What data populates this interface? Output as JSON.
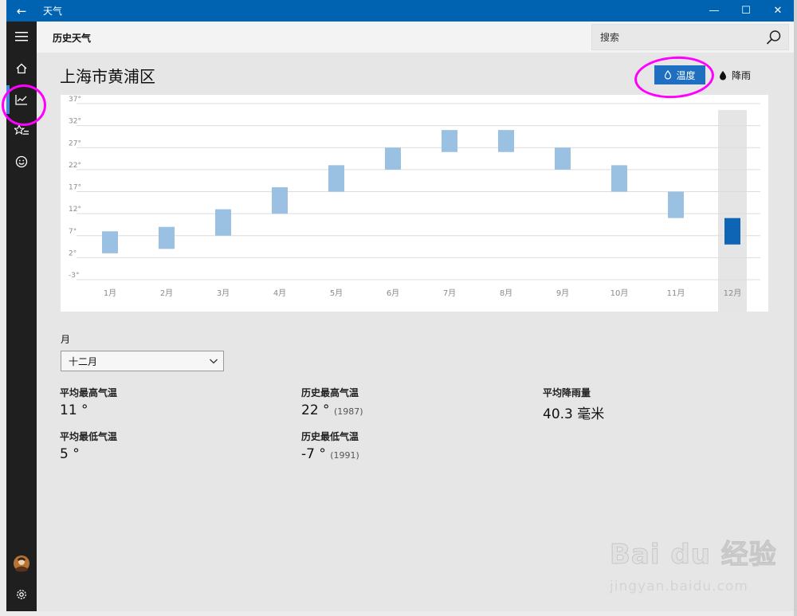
{
  "window": {
    "title": "天气",
    "back_glyph": "←",
    "min_glyph": "—",
    "max_glyph": "☐",
    "close_glyph": "✕"
  },
  "header": {
    "title": "历史天气",
    "search_placeholder": "搜索"
  },
  "location": "上海市黄浦区",
  "toggle": {
    "temperature": "温度",
    "precipitation": "降雨"
  },
  "chart_data": {
    "type": "bar",
    "categories": [
      "1月",
      "2月",
      "3月",
      "4月",
      "5月",
      "6月",
      "7月",
      "8月",
      "9月",
      "10月",
      "11月",
      "12月"
    ],
    "series": [
      {
        "low": [
          3,
          4,
          7,
          12,
          17,
          22,
          26,
          26,
          22,
          17,
          11,
          5
        ],
        "high": [
          8,
          9,
          13,
          18,
          23,
          27,
          31,
          31,
          27,
          23,
          17,
          11
        ]
      }
    ],
    "selected_index": 11,
    "y_tick_labels": [
      "37°",
      "32°",
      "27°",
      "22°",
      "17°",
      "12°",
      "7°",
      "2°",
      "-3°"
    ],
    "ylim": [
      -3,
      37
    ],
    "grid": true,
    "colors": {
      "bar": "#9ac1e1",
      "selected": "#0f65b5",
      "selected_band": "#e5e5e5"
    }
  },
  "month": {
    "label": "月",
    "selected": "十二月"
  },
  "stats": {
    "avg_high": {
      "label": "平均最高气温",
      "value": "11 °"
    },
    "avg_low": {
      "label": "平均最低气温",
      "value": "5 °"
    },
    "record_high": {
      "label": "历史最高气温",
      "value": "22 °",
      "year": "(1987)"
    },
    "record_low": {
      "label": "历史最低气温",
      "value": "-7 °",
      "year": "(1991)"
    },
    "avg_rain": {
      "label": "平均降雨量",
      "value": "40.3 毫米"
    }
  },
  "watermark": {
    "logo": "Bai du 经验",
    "url": "jingyan.baidu.com"
  }
}
